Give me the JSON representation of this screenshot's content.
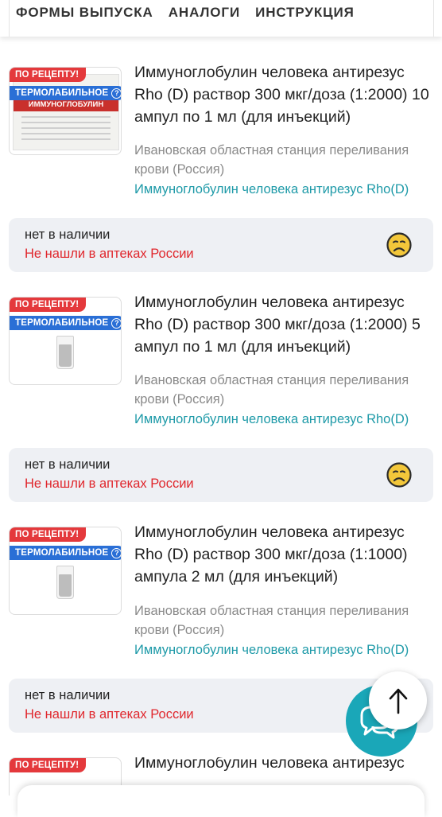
{
  "tabs": [
    "ФОРМЫ ВЫПУСКА",
    "АНАЛОГИ",
    "ИНСТРУКЦИЯ"
  ],
  "badges": {
    "rx": "ПО РЕЦЕПТУ!",
    "thermo": "ТЕРМОЛАБИЛЬНОЕ",
    "help": "?"
  },
  "products": [
    {
      "title": "Иммуноглобулин человека антирезус Rho (D) раствор 300 мкг/доза (1:2000) 10 ампул по 1 мл (для инъекций)",
      "manufacturer": "Ивановская областная станция переливания крови (Россия)",
      "inn": "Иммуноглобулин человека антирезус Rho(D)",
      "image_label": "ИММУНОГЛОБУЛИН"
    },
    {
      "title": "Иммуноглобулин человека антирезус Rho (D) раствор 300 мкг/доза (1:2000) 5 ампул по 1 мл (для инъекций)",
      "manufacturer": "Ивановская областная станция переливания крови (Россия)",
      "inn": "Иммуноглобулин человека антирезус Rho(D)"
    },
    {
      "title": "Иммуноглобулин человека антирезус Rho (D) раствор 300 мкг/доза (1:1000) ампула 2 мл (для инъекций)",
      "manufacturer": "Ивановская областная станция переливания крови (Россия)",
      "inn": "Иммуноглобулин человека антирезус Rho(D)"
    },
    {
      "title": "Иммуноглобулин человека антирезус"
    }
  ],
  "availability": {
    "status": "нет в наличии",
    "message": "Не нашли в аптеках России"
  },
  "icons": {
    "sad": "sad-face-icon",
    "up": "arrow-up-icon",
    "chat": "chat-icon"
  },
  "colors": {
    "accent": "#1e9aa8",
    "error": "#e0262c",
    "rx_badge": "#e4393c",
    "thermo_badge": "#2a6fd6",
    "stock_bg": "#eef0f4"
  }
}
